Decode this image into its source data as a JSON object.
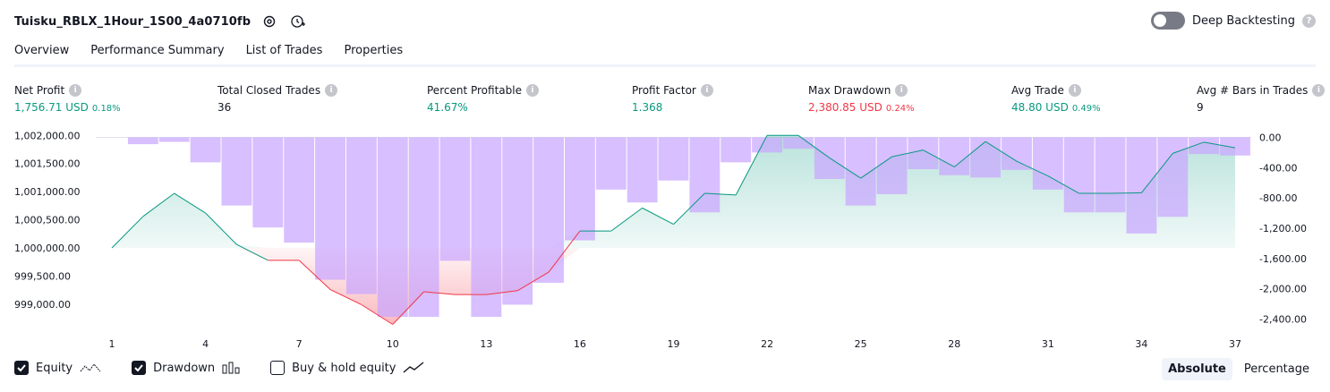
{
  "header": {
    "title": "Tuisku_RBLX_1Hour_1S00_4a0710fb",
    "settings_icon": "gear-icon",
    "alert_icon": "add-alert-icon"
  },
  "deep_backtesting": {
    "label": "Deep Backtesting",
    "enabled": false
  },
  "tabs": [
    {
      "label": "Overview",
      "active": true
    },
    {
      "label": "Performance Summary",
      "active": false
    },
    {
      "label": "List of Trades",
      "active": false
    },
    {
      "label": "Properties",
      "active": false
    }
  ],
  "metrics": [
    {
      "label": "Net Profit",
      "value": "1,756.71 USD",
      "pct": "0.18%",
      "tone": "pos"
    },
    {
      "label": "Total Closed Trades",
      "value": "36",
      "pct": "",
      "tone": "neu"
    },
    {
      "label": "Percent Profitable",
      "value": "41.67%",
      "pct": "",
      "tone": "pos"
    },
    {
      "label": "Profit Factor",
      "value": "1.368",
      "pct": "",
      "tone": "pos"
    },
    {
      "label": "Max Drawdown",
      "value": "2,380.85 USD",
      "pct": "0.24%",
      "tone": "neg"
    },
    {
      "label": "Avg Trade",
      "value": "48.80 USD",
      "pct": "0.49%",
      "tone": "pos"
    },
    {
      "label": "Avg # Bars in Trades",
      "value": "9",
      "pct": "",
      "tone": "neu"
    }
  ],
  "chart_data": {
    "type": "line",
    "x_ticks": [
      "1",
      "4",
      "7",
      "10",
      "13",
      "16",
      "19",
      "22",
      "25",
      "28",
      "31",
      "34",
      "37"
    ],
    "left_axis": {
      "ticks": [
        "1,002,000.00",
        "1,001,500.00",
        "1,001,000.00",
        "1,000,500.00",
        "1,000,000.00",
        "999,500.00",
        "999,000.00"
      ],
      "range": [
        998600,
        1002100
      ]
    },
    "right_axis": {
      "ticks": [
        "0.00",
        "-400.00",
        "-800.00",
        "-1,200.00",
        "-1,600.00",
        "-2,000.00",
        "-2,400.00"
      ],
      "range": [
        -2500,
        100
      ]
    },
    "baseline": 1000000,
    "series": [
      {
        "name": "Equity",
        "color_pos": "#089981",
        "color_neg": "#f23645",
        "x": [
          1,
          2,
          3,
          4,
          5,
          6,
          7,
          8,
          9,
          10,
          11,
          12,
          13,
          14,
          15,
          16,
          17,
          18,
          19,
          20,
          21,
          22,
          23,
          24,
          25,
          26,
          27,
          28,
          29,
          30,
          31,
          32,
          33,
          34,
          35,
          36,
          37
        ],
        "values": [
          1000000,
          1000560,
          1000970,
          1000620,
          1000060,
          999780,
          999780,
          999260,
          998990,
          998640,
          999220,
          999170,
          999170,
          999240,
          999570,
          1000300,
          1000300,
          1000710,
          1000420,
          1000970,
          1000940,
          1002000,
          1002000,
          1001600,
          1001240,
          1001620,
          1001740,
          1001440,
          1001890,
          1001540,
          1001280,
          1000970,
          1000970,
          1000980,
          1001680,
          1001880,
          1001780
        ]
      },
      {
        "name": "Drawdown",
        "color": "#c9a6ff",
        "x": [
          1,
          2,
          3,
          4,
          5,
          6,
          7,
          8,
          9,
          10,
          11,
          12,
          13,
          14,
          15,
          16,
          17,
          18,
          19,
          20,
          21,
          22,
          23,
          24,
          25,
          26,
          27,
          28,
          29,
          30,
          31,
          32,
          33,
          34,
          35,
          36,
          37
        ],
        "values": [
          0,
          -90,
          -60,
          -330,
          -900,
          -1190,
          -1390,
          -1880,
          -2070,
          -2370,
          -2370,
          -1630,
          -2370,
          -2210,
          -1920,
          -1360,
          -690,
          -860,
          -570,
          -990,
          -330,
          -200,
          -150,
          -550,
          -900,
          -750,
          -420,
          -500,
          -530,
          -430,
          -690,
          -990,
          -990,
          -1270,
          -1050,
          -220,
          -240
        ]
      }
    ],
    "legend": [
      "Equity",
      "Drawdown",
      "Buy & hold equity"
    ]
  },
  "footer": {
    "toggles": [
      {
        "label": "Equity",
        "checked": true,
        "icon": "equity-line-icon"
      },
      {
        "label": "Drawdown",
        "checked": true,
        "icon": "drawdown-bars-icon"
      },
      {
        "label": "Buy & hold equity",
        "checked": false,
        "icon": "buy-hold-line-icon"
      }
    ],
    "modes": [
      {
        "label": "Absolute",
        "active": true
      },
      {
        "label": "Percentage",
        "active": false
      }
    ]
  }
}
